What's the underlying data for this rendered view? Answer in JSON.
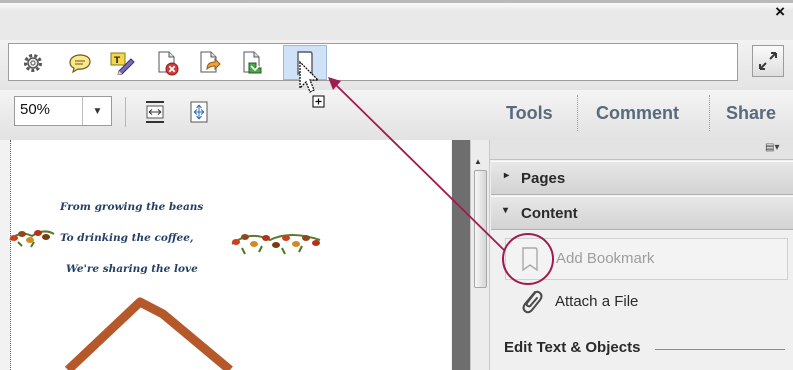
{
  "window": {
    "close_glyph": "×"
  },
  "quick_tools": {
    "icons": [
      "gear-icon",
      "comment-bubble-icon",
      "sticky-pen-icon",
      "delete-page-icon",
      "export-page-icon",
      "extract-page-icon",
      "add-bookmark-icon"
    ],
    "expand_icon": "expand-arrows-icon"
  },
  "toolbar": {
    "zoom_value": "50%",
    "zoom_dropdown_glyph": "▼",
    "fit_width_icon": "fit-width-icon",
    "fit_page_icon": "fit-page-icon"
  },
  "panel_tabs": {
    "tools": "Tools",
    "comment": "Comment",
    "share": "Share"
  },
  "document": {
    "poem_lines": [
      "From growing the beans",
      "To drinking the coffee,",
      "We're sharing the love"
    ]
  },
  "right_panel": {
    "options_glyph": "▤▾",
    "pages_arrow": "▸",
    "pages_label": "Pages",
    "content_arrow": "▾",
    "content_label": "Content",
    "add_bookmark_label": "Add Bookmark",
    "attach_file_label": "Attach a File",
    "edit_section_label": "Edit Text & Objects"
  },
  "colors": {
    "panel_tab_text": "#596a7c",
    "callout_line": "#a01c4e",
    "selected_tool_bg": "#cfe2f7",
    "poem_text": "#243f66",
    "chart_line": "#b5582a"
  }
}
